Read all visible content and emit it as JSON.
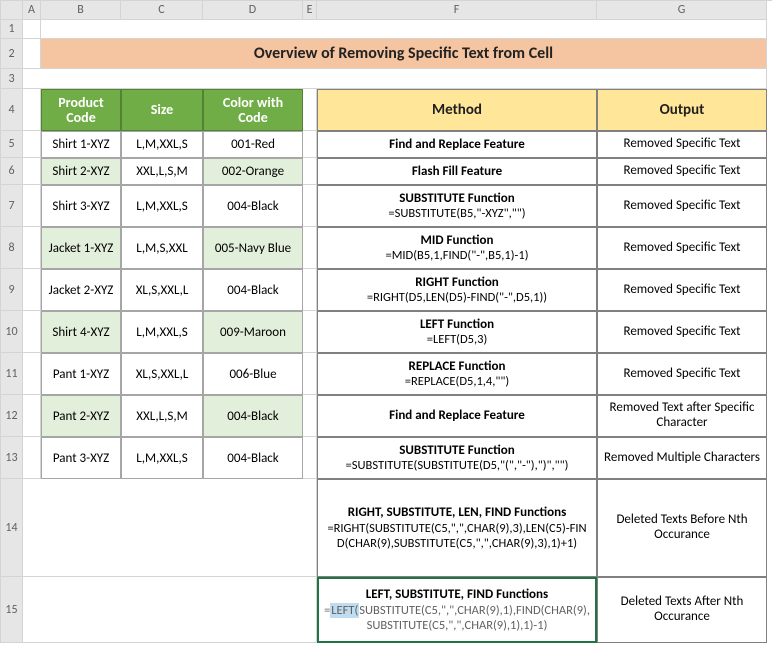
{
  "cols": [
    "A",
    "B",
    "C",
    "D",
    "E",
    "F",
    "G"
  ],
  "rows": [
    "1",
    "2",
    "3",
    "4",
    "5",
    "6",
    "7",
    "8",
    "9",
    "10",
    "11",
    "12",
    "13",
    "14",
    "15"
  ],
  "title": "Overview of Removing Specific Text from Cell",
  "left_headers": {
    "product": "Product Code",
    "size": "Size",
    "color": "Color with Code"
  },
  "right_headers": {
    "method": "Method",
    "output": "Output"
  },
  "left": [
    {
      "p": "Shirt 1-XYZ",
      "s": "L,M,XXL,S",
      "c": "001-Red",
      "shade": false
    },
    {
      "p": "Shirt 2-XYZ",
      "s": "XXL,L,S,M",
      "c": "002-Orange",
      "shade": true
    },
    {
      "p": "Shirt 3-XYZ",
      "s": "L,M,XXL,S",
      "c": "004-Black",
      "shade": false
    },
    {
      "p": "Jacket 1-XYZ",
      "s": "L,M,S,XXL",
      "c": "005-Navy Blue",
      "shade": true
    },
    {
      "p": "Jacket 2-XYZ",
      "s": "XL,S,XXL,L",
      "c": "004-Black",
      "shade": false
    },
    {
      "p": "Shirt 4-XYZ",
      "s": "L,M,XXL,S",
      "c": "009-Maroon",
      "shade": true
    },
    {
      "p": "Pant 1-XYZ",
      "s": "XL,S,XXL,L",
      "c": "006-Blue",
      "shade": false
    },
    {
      "p": "Pant 2-XYZ",
      "s": "XXL,L,S,M",
      "c": "004-Black",
      "shade": true
    },
    {
      "p": "Pant 3-XYZ",
      "s": "L,M,XXL,S",
      "c": "004-Black",
      "shade": false
    }
  ],
  "right": [
    {
      "m_t": "Find and Replace Feature",
      "m_f": "",
      "o": "Removed Specific Text"
    },
    {
      "m_t": "Flash Fill Feature",
      "m_f": "",
      "o": "Removed Specific Text"
    },
    {
      "m_t": "SUBSTITUTE Function",
      "m_f": "=SUBSTITUTE(B5,\"-XYZ\",\"\")",
      "o": "Removed Specific Text"
    },
    {
      "m_t": "MID Function",
      "m_f": "=MID(B5,1,FIND(\"-\",B5,1)-1)",
      "o": "Removed Specific Text"
    },
    {
      "m_t": "RIGHT Function",
      "m_f": "=RIGHT(D5,LEN(D5)-FIND(\"-\",D5,1))",
      "o": "Removed Specific Text"
    },
    {
      "m_t": "LEFT Function",
      "m_f": "=LEFT(D5,3)",
      "o": "Removed Specific Text"
    },
    {
      "m_t": "REPLACE Function",
      "m_f": "=REPLACE(D5,1,4,\"\")",
      "o": "Removed Specific Text"
    },
    {
      "m_t": "Find and Replace Feature",
      "m_f": "",
      "o": "Removed Text after Specific Character"
    },
    {
      "m_t": "SUBSTITUTE Function",
      "m_f": "=SUBSTITUTE(SUBSTITUTE(D5,\"(\",\"-\"),\")\",\"\")",
      "o": "Removed Multiple Characters"
    },
    {
      "m_t": "RIGHT, SUBSTITUTE, LEN, FIND Functions",
      "m_f": "=RIGHT(SUBSTITUTE(C5,\",\",CHAR(9),3),LEN(C5)-FIND(CHAR(9),SUBSTITUTE(C5,\",\",CHAR(9),3),1)+1)",
      "o": "Deleted Texts Before Nth Occurance"
    },
    {
      "m_t": "LEFT, SUBSTITUTE, FIND Functions",
      "m_f": "=LEFT(SUBSTITUTE(C5,\",\",CHAR(9),1),FIND(CHAR(9),SUBSTITUTE(C5,\",\",CHAR(9),1),1)-1)",
      "o": "Deleted Texts After Nth Occurance"
    }
  ],
  "selected_formula_parts": {
    "pre": "=",
    "fn": "LEFT(",
    "a1": "SUBSTITUTE(C5,\",\",CHAR(9),1)",
    "sep": ",",
    "a2": "FIND(CHAR(9),SUBSTITUTE(C5,\",\",CHAR(9),1),1)-1)"
  }
}
